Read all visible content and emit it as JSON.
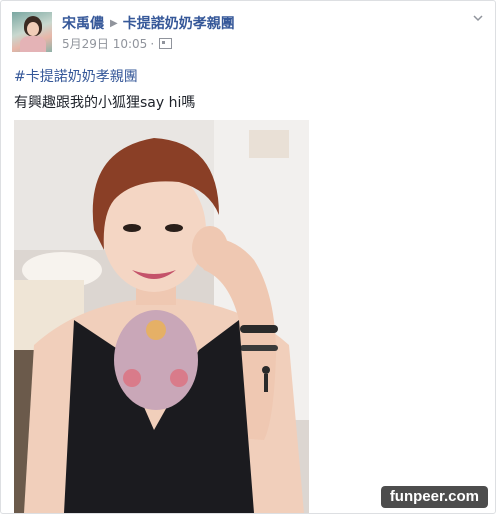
{
  "post": {
    "author": "宋禹儂",
    "group": "卡提諾奶奶孝親團",
    "date": "5月29日",
    "time": "10:05",
    "hashtag": "#卡提諾奶奶孝親團",
    "message": "有興趣跟我的小狐狸say hi嗎"
  },
  "watermark": "funpeer.com",
  "icons": [
    "triangle-right-icon",
    "audience-icon",
    "chevron-down-icon"
  ],
  "colors": {
    "link": "#365899",
    "meta": "#90949c",
    "text": "#1d2129",
    "watermark_bg": "#4d4d4d"
  }
}
